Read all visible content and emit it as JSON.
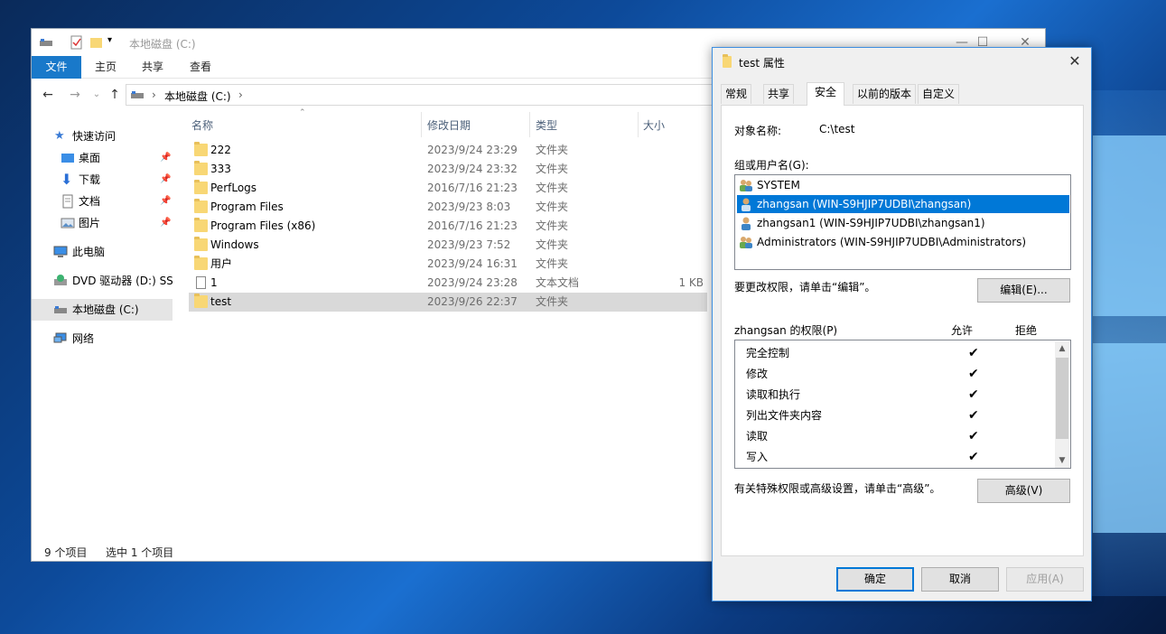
{
  "explorer": {
    "title": "本地磁盘 (C:)",
    "window_buttons": {
      "minimize": "—",
      "maximize": "☐",
      "close": "✕"
    },
    "ribbon_tabs": [
      "文件",
      "主页",
      "共享",
      "查看"
    ],
    "address_path": "本地磁盘 (C:)",
    "address_chevron": "›",
    "nav": {
      "back": "←",
      "forward": "→",
      "recent": "⌄",
      "up": "↑"
    },
    "sidebar": [
      {
        "label": "快速访问",
        "pinned": false
      },
      {
        "label": "桌面",
        "pinned": true
      },
      {
        "label": "下载",
        "pinned": true
      },
      {
        "label": "文档",
        "pinned": true
      },
      {
        "label": "图片",
        "pinned": true
      },
      {
        "label": "此电脑",
        "pinned": false
      },
      {
        "label": "DVD 驱动器 (D:) SSS",
        "pinned": false
      },
      {
        "label": "本地磁盘 (C:)",
        "pinned": false
      },
      {
        "label": "网络",
        "pinned": false
      }
    ],
    "pin_glyph": "📌",
    "columns": {
      "name": "名称",
      "date": "修改日期",
      "type": "类型",
      "size": "大小"
    },
    "files": [
      {
        "name": "222",
        "date": "2023/9/24 23:29",
        "type": "文件夹",
        "size": "",
        "icon": "folder-icon"
      },
      {
        "name": "333",
        "date": "2023/9/24 23:32",
        "type": "文件夹",
        "size": "",
        "icon": "folder-icon"
      },
      {
        "name": "PerfLogs",
        "date": "2016/7/16 21:23",
        "type": "文件夹",
        "size": "",
        "icon": "folder-icon"
      },
      {
        "name": "Program Files",
        "date": "2023/9/23 8:03",
        "type": "文件夹",
        "size": "",
        "icon": "folder-icon"
      },
      {
        "name": "Program Files (x86)",
        "date": "2016/7/16 21:23",
        "type": "文件夹",
        "size": "",
        "icon": "folder-icon"
      },
      {
        "name": "Windows",
        "date": "2023/9/23 7:52",
        "type": "文件夹",
        "size": "",
        "icon": "folder-icon"
      },
      {
        "name": "用户",
        "date": "2023/9/24 16:31",
        "type": "文件夹",
        "size": "",
        "icon": "folder-icon"
      },
      {
        "name": "1",
        "date": "2023/9/24 23:28",
        "type": "文本文档",
        "size": "1 KB",
        "icon": "text-file-icon"
      },
      {
        "name": "test",
        "date": "2023/9/26 22:37",
        "type": "文件夹",
        "size": "",
        "icon": "folder-icon"
      }
    ],
    "status": {
      "count": "9 个项目",
      "selected": "选中 1 个项目"
    }
  },
  "dialog": {
    "title": "test 属性",
    "close": "✕",
    "tabs": [
      "常规",
      "共享",
      "安全",
      "以前的版本",
      "自定义"
    ],
    "active_tab": "安全",
    "object_label": "对象名称:",
    "object_value": "C:\\test",
    "group_label": "组或用户名(G):",
    "users": [
      {
        "name": "SYSTEM",
        "selected": false
      },
      {
        "name": "zhangsan (WIN-S9HJIP7UDBI\\zhangsan)",
        "selected": true
      },
      {
        "name": "zhangsan1 (WIN-S9HJIP7UDBI\\zhangsan1)",
        "selected": false
      },
      {
        "name": "Administrators (WIN-S9HJIP7UDBI\\Administrators)",
        "selected": false
      }
    ],
    "edit_hint": "要更改权限，请单击“编辑”。",
    "edit_button": "编辑(E)...",
    "perm_header": "zhangsan 的权限(P)",
    "allow_header": "允许",
    "deny_header": "拒绝",
    "permissions": [
      {
        "name": "完全控制",
        "allow": "✔",
        "deny": ""
      },
      {
        "name": "修改",
        "allow": "✔",
        "deny": ""
      },
      {
        "name": "读取和执行",
        "allow": "✔",
        "deny": ""
      },
      {
        "name": "列出文件夹内容",
        "allow": "✔",
        "deny": ""
      },
      {
        "name": "读取",
        "allow": "✔",
        "deny": ""
      },
      {
        "name": "写入",
        "allow": "✔",
        "deny": ""
      }
    ],
    "advanced_hint": "有关特殊权限或高级设置，请单击“高级”。",
    "advanced_button": "高级(V)",
    "ok": "确定",
    "cancel": "取消",
    "apply": "应用(A)",
    "scroll_up": "▲",
    "scroll_down": "▼"
  },
  "colors": {
    "accent": "#0078d7",
    "ribbon_file": "#1979ca",
    "folder": "#f8d775",
    "selected_row": "#d9d9d9"
  }
}
